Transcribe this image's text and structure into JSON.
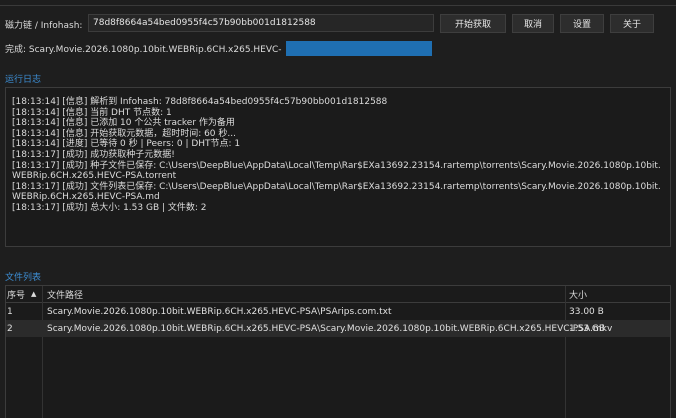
{
  "magnet": {
    "label": "磁力链 / Infohash:",
    "value": "78d8f8664a54bed0955f4c57b90bb001d1812588"
  },
  "buttons": {
    "start": "开始获取",
    "cancel": "取消",
    "settings": "设置",
    "about": "关于"
  },
  "status": {
    "text": "完成: Scary.Movie.2026.1080p.10bit.WEBRip.6CH.x265.HEVC-",
    "progress_percent": 100
  },
  "log": {
    "title": "运行日志",
    "lines": [
      "[18:13:14] [信息] 解析到 Infohash: 78d8f8664a54bed0955f4c57b90bb001d1812588",
      "[18:13:14] [信息] 当前 DHT 节点数: 1",
      "[18:13:14] [信息] 已添加 10 个公共 tracker 作为备用",
      "[18:13:14] [信息] 开始获取元数据，超时时间: 60 秒...",
      "[18:13:14] [进度] 已等待 0 秒 | Peers: 0 | DHT节点: 1",
      "[18:13:17] [成功] 成功获取种子元数据!",
      "[18:13:17] [成功] 种子文件已保存: C:\\Users\\DeepBlue\\AppData\\Local\\Temp\\Rar$EXa13692.23154.rartemp\\torrents\\Scary.Movie.2026.1080p.10bit.WEBRip.6CH.x265.HEVC-PSA.torrent",
      "[18:13:17] [成功] 文件列表已保存: C:\\Users\\DeepBlue\\AppData\\Local\\Temp\\Rar$EXa13692.23154.rartemp\\torrents\\Scary.Movie.2026.1080p.10bit.WEBRip.6CH.x265.HEVC-PSA.md",
      "[18:13:17] [成功] 总大小: 1.53 GB | 文件数: 2"
    ]
  },
  "files": {
    "title": "文件列表",
    "columns": {
      "index": "序号",
      "path": "文件路径",
      "size": "大小"
    },
    "sort_icon": "sort-ascending-icon",
    "rows": [
      {
        "index": "1",
        "path": "Scary.Movie.2026.1080p.10bit.WEBRip.6CH.x265.HEVC-PSA\\PSArips.com.txt",
        "size": "33.00 B"
      },
      {
        "index": "2",
        "path": "Scary.Movie.2026.1080p.10bit.WEBRip.6CH.x265.HEVC-PSA\\Scary.Movie.2026.1080p.10bit.WEBRip.6CH.x265.HEVC-PSA.mkv",
        "size": "1.53 GB"
      }
    ]
  },
  "colors": {
    "accent": "#3d8fd6",
    "progress": "#1f6fb2",
    "background": "#1e1e1e"
  }
}
